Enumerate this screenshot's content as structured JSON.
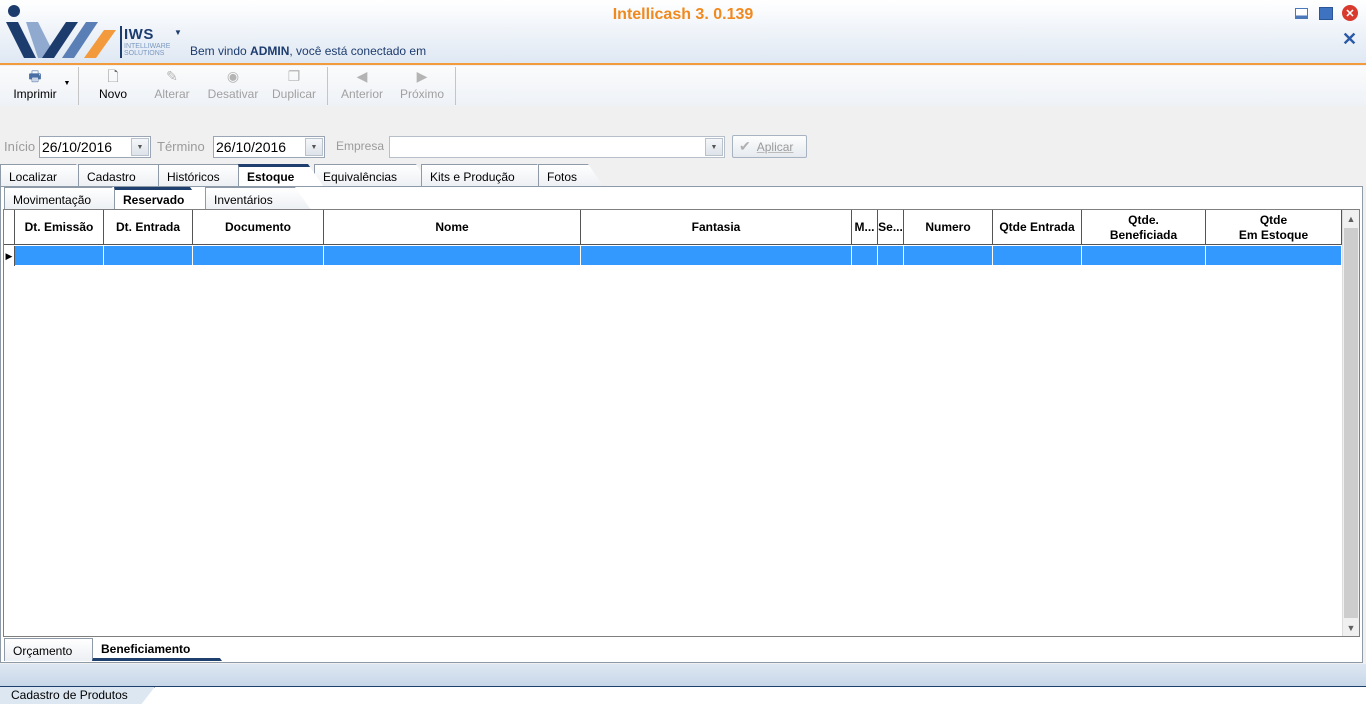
{
  "app": {
    "title": "Intellicash 3. 0.139",
    "logo_name": "IWS",
    "logo_sub": "INTELLIWARE SOLUTIONS",
    "welcome_prefix": "Bem vindo ",
    "welcome_user": "ADMIN",
    "welcome_suffix": ", você está conectado em"
  },
  "toolbar": {
    "imprimir": "Imprimir",
    "novo": "Novo",
    "alterar": "Alterar",
    "desativar": "Desativar",
    "duplicar": "Duplicar",
    "anterior": "Anterior",
    "proximo": "Próximo"
  },
  "filter": {
    "inicio_label": "Início",
    "inicio_value": "26/10/2016",
    "termino_label": "Término",
    "termino_value": "26/10/2016",
    "empresa_label": "Empresa",
    "empresa_value": "",
    "aplicar": "Aplicar"
  },
  "main_tabs": [
    "Localizar",
    "Cadastro",
    "Históricos",
    "Estoque",
    "Equivalências",
    "Kits e Produção",
    "Fotos"
  ],
  "sub_tabs": [
    "Movimentação",
    "Reservado",
    "Inventários"
  ],
  "grid": {
    "columns": [
      "Dt. Emissão",
      "Dt. Entrada",
      "Documento",
      "Nome",
      "Fantasia",
      "M...",
      "Se...",
      "Numero",
      "Qtde Entrada",
      "Qtde.\nBeneficiada",
      "Qtde\nEm Estoque"
    ]
  },
  "bottom_tabs": [
    "Orçamento",
    "Beneficiamento"
  ],
  "window_tab": "Cadastro de Produtos",
  "colors": {
    "accent": "#f0891e",
    "brand_blue": "#1f3f6e",
    "selection": "#3399ff"
  }
}
